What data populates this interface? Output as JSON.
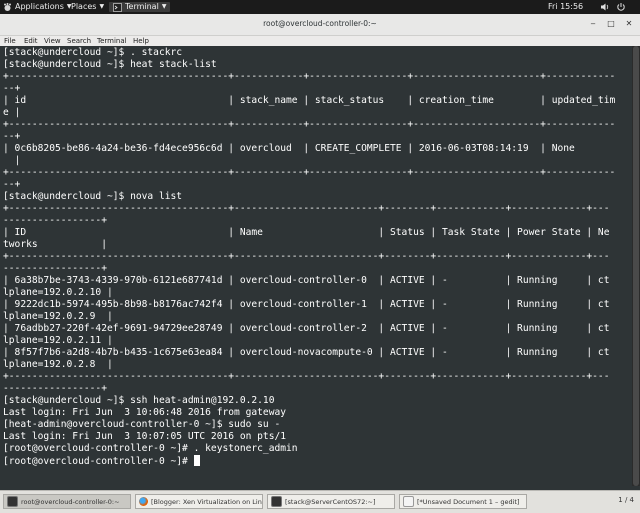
{
  "topbar": {
    "applications": "Applications",
    "places": "Places",
    "terminal_app": "Terminal",
    "clock": "Fri 15:56"
  },
  "window": {
    "title": "root@overcloud-controller-0:~",
    "menu": [
      "File",
      "Edit",
      "View",
      "Search",
      "Terminal",
      "Help"
    ]
  },
  "terminal": {
    "lines": [
      "[stack@undercloud ~]$ . stackrc",
      "[stack@undercloud ~]$ heat stack-list",
      "+--------------------------------------+------------+-----------------+----------------------+------------",
      "--+",
      "| id                                   | stack_name | stack_status    | creation_time        | updated_tim",
      "e |",
      "+--------------------------------------+------------+-----------------+----------------------+------------",
      "--+",
      "| 0c6b8205-be86-4a24-be36-fd4ece956c6d | overcloud  | CREATE_COMPLETE | 2016-06-03T08:14:19  | None",
      "  |",
      "+--------------------------------------+------------+-----------------+----------------------+------------",
      "--+",
      "[stack@undercloud ~]$ nova list",
      "+--------------------------------------+-------------------------+--------+------------+-------------+---",
      "-----------------+",
      "| ID                                   | Name                    | Status | Task State | Power State | Ne",
      "tworks           |",
      "+--------------------------------------+-------------------------+--------+------------+-------------+---",
      "-----------------+",
      "| 6a38b7be-3743-4339-970b-6121e687741d | overcloud-controller-0  | ACTIVE | -          | Running     | ct",
      "lplane=192.0.2.10 |",
      "| 9222dc1b-5974-495b-8b98-b8176ac742f4 | overcloud-controller-1  | ACTIVE | -          | Running     | ct",
      "lplane=192.0.2.9  |",
      "| 76adbb27-220f-42ef-9691-94729ee28749 | overcloud-controller-2  | ACTIVE | -          | Running     | ct",
      "lplane=192.0.2.11 |",
      "| 8f57f7b6-a2d8-4b7b-b435-1c675e63ea84 | overcloud-novacompute-0 | ACTIVE | -          | Running     | ct",
      "lplane=192.0.2.8  |",
      "+--------------------------------------+-------------------------+--------+------------+-------------+---",
      "-----------------+",
      "[stack@undercloud ~]$ ssh heat-admin@192.0.2.10",
      "Last login: Fri Jun  3 10:06:48 2016 from gateway",
      "[heat-admin@overcloud-controller-0 ~]$ sudo su -",
      "Last login: Fri Jun  3 10:07:05 UTC 2016 on pts/1",
      "[root@overcloud-controller-0 ~]# . keystonerc_admin",
      "[root@overcloud-controller-0 ~]# "
    ]
  },
  "taskbar": {
    "items": [
      "root@overcloud-controller-0:~",
      "[Blogger: Xen Virtualization on Lin...",
      "[stack@ServerCentOS72:~]",
      "[*Unsaved Document 1 – gedit]"
    ],
    "workspace": "1 / 4"
  },
  "colors": {
    "terminal_bg": "#2e3436",
    "terminal_fg": "#ffffff"
  }
}
